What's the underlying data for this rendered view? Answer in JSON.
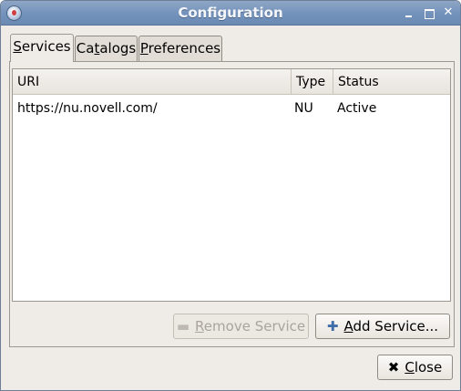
{
  "window": {
    "title": "Configuration"
  },
  "tabs": {
    "services": {
      "pre": "",
      "mnemonic": "S",
      "post": "ervices"
    },
    "catalogs": {
      "pre": "Ca",
      "mnemonic": "t",
      "post": "alogs"
    },
    "preferences": {
      "pre": "",
      "mnemonic": "P",
      "post": "references"
    }
  },
  "services_list": {
    "columns": {
      "uri": "URI",
      "type": "Type",
      "status": "Status"
    },
    "rows": [
      {
        "uri": "https://nu.novell.com/",
        "type": "NU",
        "status": "Active"
      }
    ]
  },
  "buttons": {
    "remove_service": {
      "icon": "minus-icon",
      "pre": "",
      "mnemonic": "R",
      "post": "emove Service",
      "enabled": false
    },
    "add_service": {
      "icon": "plus-icon",
      "pre": "",
      "mnemonic": "A",
      "post": "dd Service...",
      "enabled": true
    },
    "close": {
      "icon": "close-icon",
      "pre": "",
      "mnemonic": "C",
      "post": "lose",
      "enabled": true
    }
  }
}
